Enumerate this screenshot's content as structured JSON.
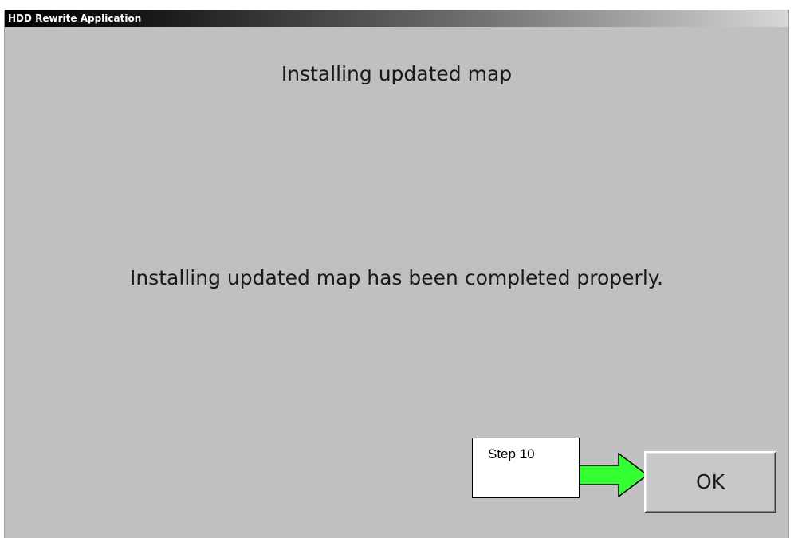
{
  "window": {
    "title": "HDD Rewrite Application"
  },
  "main": {
    "heading": "Installing updated map",
    "message": "Installing updated map has been completed properly."
  },
  "annotation": {
    "step_label": "Step 10",
    "arrow_color": "#33ff33"
  },
  "buttons": {
    "ok_label": "OK"
  }
}
